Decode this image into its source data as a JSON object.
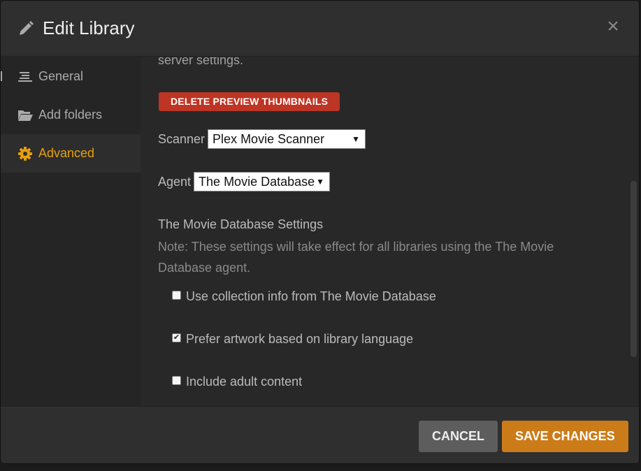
{
  "dialog": {
    "title": "Edit Library",
    "title_icon": "pencil-icon",
    "close_glyph": "×"
  },
  "sidebar": {
    "items": [
      {
        "label": "General",
        "icon": "lines-icon",
        "active": false
      },
      {
        "label": "Add folders",
        "icon": "folder-icon",
        "active": false
      },
      {
        "label": "Advanced",
        "icon": "gear-icon",
        "active": true
      }
    ]
  },
  "content": {
    "intro_text": "server settings.",
    "delete_thumbnails_label": "DELETE PREVIEW THUMBNAILS",
    "scanner": {
      "label": "Scanner",
      "value": "Plex Movie Scanner"
    },
    "agent": {
      "label": "Agent",
      "value": "The Movie Database"
    },
    "agent_settings_title": "The Movie Database Settings",
    "agent_settings_note": "Note: These settings will take effect for all libraries using the The Movie Database agent.",
    "options": [
      {
        "label": "Use collection info from The Movie Database",
        "checked": false
      },
      {
        "label": "Prefer artwork based on library language",
        "checked": true
      },
      {
        "label": "Include adult content",
        "checked": false
      }
    ]
  },
  "footer": {
    "cancel_label": "CANCEL",
    "save_label": "SAVE CHANGES"
  },
  "colors": {
    "accent": "#e5a00d",
    "save_button": "#cc7b19",
    "danger_button": "#bd3524",
    "cancel_button": "#5d5d5d"
  }
}
